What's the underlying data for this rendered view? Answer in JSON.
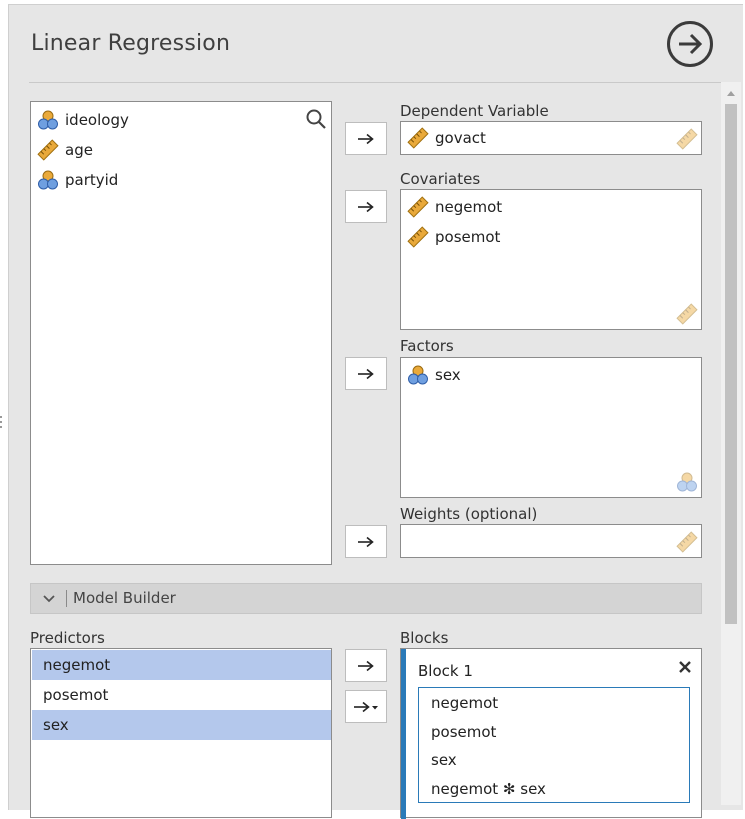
{
  "window": {
    "title": "Linear Regression"
  },
  "variables": [
    {
      "name": "ideology",
      "icon": "nominal-icon"
    },
    {
      "name": "age",
      "icon": "scale-ruler-icon"
    },
    {
      "name": "partyid",
      "icon": "nominal-icon"
    }
  ],
  "dependent": {
    "label": "Dependent Variable",
    "value": "govact"
  },
  "covariates": {
    "label": "Covariates",
    "items": [
      "negemot",
      "posemot"
    ]
  },
  "factors": {
    "label": "Factors",
    "items": [
      "sex"
    ]
  },
  "weights": {
    "label": "Weights (optional)"
  },
  "model_builder": {
    "label": "Model Builder"
  },
  "predictors": {
    "label": "Predictors",
    "items": [
      "negemot",
      "posemot",
      "sex"
    ],
    "selected": [
      "negemot",
      "sex"
    ]
  },
  "blocks": {
    "label": "Blocks",
    "block1": {
      "title": "Block 1",
      "terms": [
        "negemot",
        "posemot",
        "sex",
        "negemot ✻ sex"
      ]
    }
  },
  "colors": {
    "selection": "#b4c8ec",
    "accent": "#2a7ab8",
    "ruler": "#e9a93a",
    "nominal_blue": "#6f9fe0"
  }
}
